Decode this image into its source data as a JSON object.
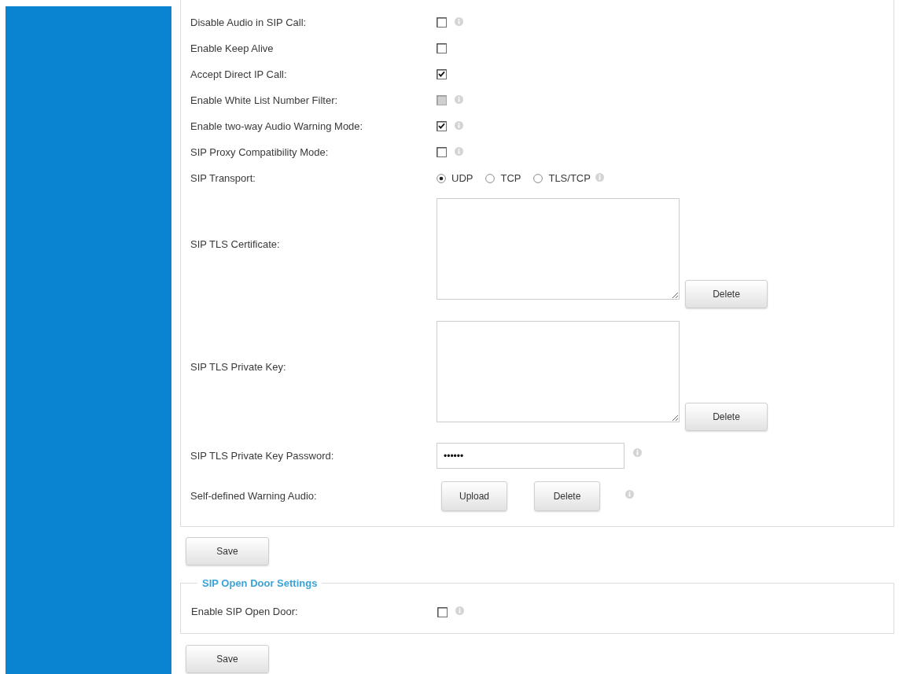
{
  "sip_settings": {
    "rows": [
      {
        "kind": "checkbox",
        "label": "Disable Audio in SIP Call:",
        "checked": false,
        "disabled": false,
        "info": true
      },
      {
        "kind": "checkbox",
        "label": "Enable Keep Alive",
        "checked": false,
        "disabled": false,
        "info": false
      },
      {
        "kind": "checkbox",
        "label": "Accept Direct IP Call:",
        "checked": true,
        "disabled": false,
        "info": false
      },
      {
        "kind": "checkbox",
        "label": "Enable White List Number Filter:",
        "checked": false,
        "disabled": true,
        "info": true
      },
      {
        "kind": "checkbox",
        "label": "Enable two-way Audio Warning Mode:",
        "checked": true,
        "disabled": false,
        "info": true
      },
      {
        "kind": "checkbox",
        "label": "SIP Proxy Compatibility Mode:",
        "checked": false,
        "disabled": false,
        "info": true
      },
      {
        "kind": "radio",
        "label": "SIP Transport:",
        "options": [
          {
            "label": "UDP",
            "selected": true
          },
          {
            "label": "TCP",
            "selected": false
          },
          {
            "label": "TLS/TCP",
            "selected": false
          }
        ],
        "info": true
      },
      {
        "kind": "textarea",
        "label": "SIP TLS Certificate:",
        "buttons": [
          "Delete"
        ]
      },
      {
        "kind": "textarea",
        "label": "SIP TLS Private Key:",
        "buttons": [
          "Delete"
        ]
      },
      {
        "kind": "password",
        "label": "SIP TLS Private Key Password:",
        "value": "••••••",
        "info": true
      },
      {
        "kind": "upload",
        "label": "Self-defined Warning Audio:",
        "buttons": [
          "Upload",
          "Delete"
        ],
        "info": true
      }
    ],
    "save_button": "Save"
  },
  "open_door": {
    "legend": "SIP Open Door Settings",
    "rows": [
      {
        "kind": "checkbox",
        "label": "Enable SIP Open Door:",
        "checked": false,
        "disabled": false,
        "info": true
      }
    ],
    "save_button": "Save"
  }
}
